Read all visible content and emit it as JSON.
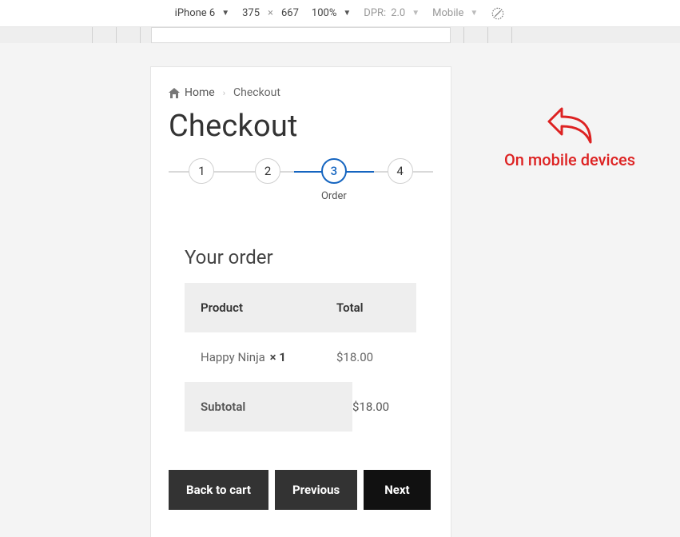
{
  "devtools": {
    "device": "iPhone 6",
    "width": "375",
    "height": "667",
    "zoom": "100%",
    "dpr_label": "DPR:",
    "dpr_value": "2.0",
    "mode": "Mobile"
  },
  "annotation": {
    "text": "On mobile devices"
  },
  "breadcrumb": {
    "home": "Home",
    "current": "Checkout"
  },
  "page": {
    "title": "Checkout"
  },
  "stepper": {
    "steps": [
      {
        "num": "1"
      },
      {
        "num": "2"
      },
      {
        "num": "3",
        "label": "Order"
      },
      {
        "num": "4"
      }
    ],
    "active_index": 2
  },
  "order": {
    "section_title": "Your order",
    "header_product": "Product",
    "header_total": "Total",
    "items": [
      {
        "name": "Happy Ninja",
        "qty": "× 1",
        "price": "$18.00"
      }
    ],
    "subtotal_label": "Subtotal",
    "subtotal_value": "$18.00"
  },
  "buttons": {
    "back": "Back to cart",
    "prev": "Previous",
    "next": "Next"
  }
}
